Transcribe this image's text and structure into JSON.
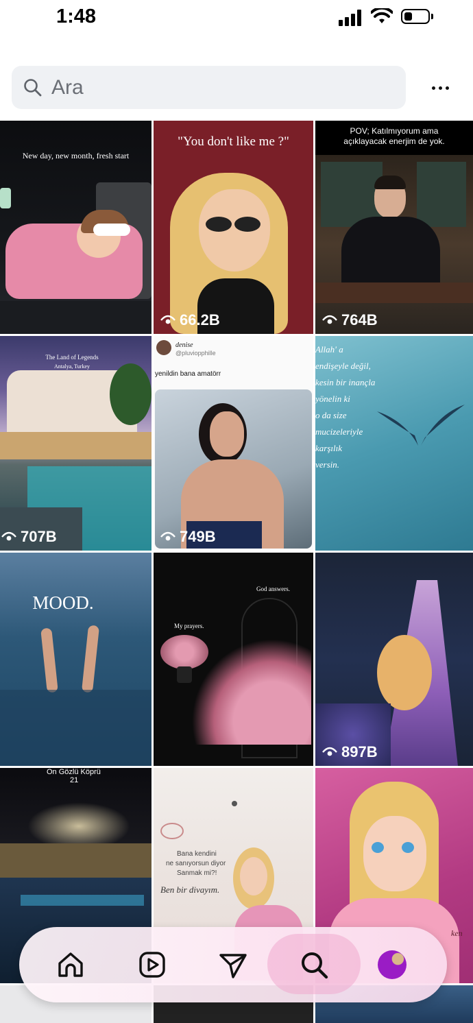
{
  "status_bar": {
    "time": "1:48",
    "battery_level": 0.3
  },
  "search": {
    "placeholder": "Ara",
    "more_icon": "more-horizontal-icon"
  },
  "tiles": {
    "t1": {
      "caption": "New day, new month, fresh start"
    },
    "t2": {
      "caption": "\"You don't like me ?\"",
      "views": "66.2B"
    },
    "t3": {
      "caption_line1": "POV; Katılmıyorum ama",
      "caption_line2": "açıklayacak enerjim de yok.",
      "views": "764B"
    },
    "t4": {
      "caption_line1": "The Land of Legends",
      "caption_line2": "Antalya, Turkey",
      "views": "707B"
    },
    "t5": {
      "username": "denise",
      "handle": "@pluviopphille",
      "post_text": "yenildin bana amatörr",
      "views": "749B"
    },
    "t6": {
      "line1": "Allah' a",
      "line2": "endişeyle değil,",
      "line3": "kesin bir inançla",
      "line4": "yönelin ki",
      "line5": "o da size",
      "line6": "mucizeleriyle",
      "line7": "karşılık",
      "line8": "versin."
    },
    "t7": {
      "caption": "MOOD."
    },
    "t8": {
      "caption1": "God answers.",
      "caption2": "My prayers."
    },
    "t9": {
      "views": "897B"
    },
    "t10": {
      "line1": "On Gözlü Köprü",
      "line2": "21"
    },
    "t11": {
      "line1": "Bana kendini",
      "line2": "ne sanıyorsun diyor",
      "line3": "Sanmak mi?!",
      "line4": "Ben bir divayım."
    },
    "t12": {
      "partial": "ken"
    }
  },
  "nav": {
    "items": [
      "home-icon",
      "reels-icon",
      "direct-send-icon",
      "search-icon",
      "profile-avatar"
    ],
    "active": "search"
  },
  "colors": {
    "accent_active": "#f0aacd",
    "avatar": "#9a1cc5"
  }
}
